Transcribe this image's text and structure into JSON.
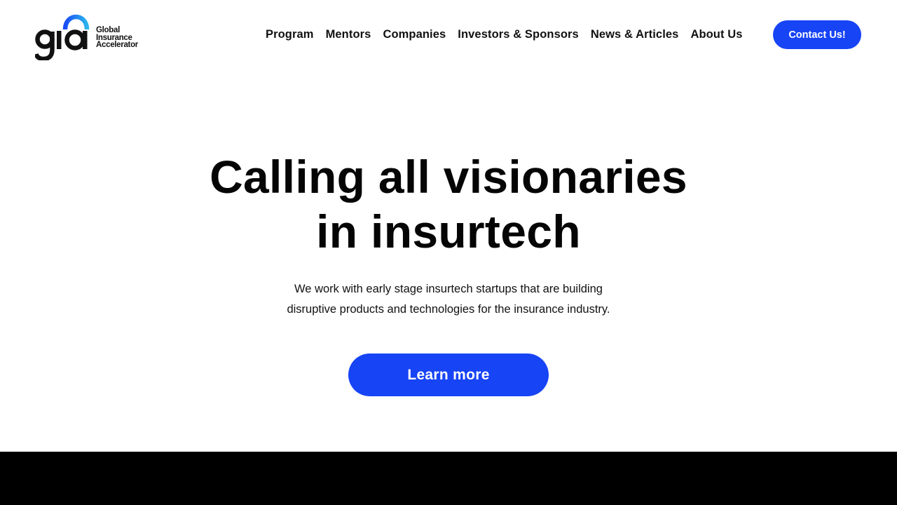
{
  "brand": {
    "logo_letters": "gia",
    "logo_line1": "Global",
    "logo_line2": "Insurance",
    "logo_line3": "Accelerator",
    "arc_colors": [
      "#1a4cf6",
      "#2bb5ee"
    ]
  },
  "nav": {
    "items": [
      {
        "label": "Program"
      },
      {
        "label": "Mentors"
      },
      {
        "label": "Companies"
      },
      {
        "label": "Investors & Sponsors"
      },
      {
        "label": "News & Articles"
      },
      {
        "label": "About Us"
      }
    ],
    "cta_label": "Contact Us!"
  },
  "hero": {
    "title_line1": "Calling all visionaries",
    "title_line2": "in insurtech",
    "subtitle_line1": "We work with early stage insurtech startups that are building",
    "subtitle_line2": "disruptive products and technologies for the insurance industry.",
    "button_label": "Learn more"
  },
  "colors": {
    "accent": "#1744f5",
    "text": "#050505",
    "background": "#ffffff",
    "footer": "#000000"
  }
}
